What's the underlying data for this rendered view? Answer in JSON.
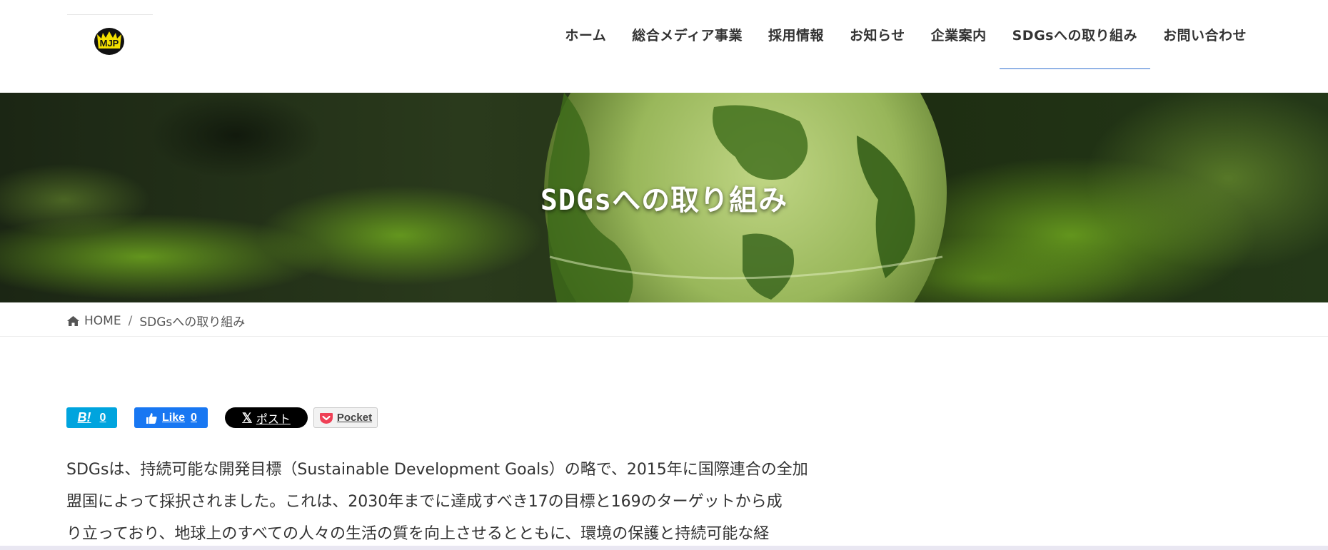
{
  "header": {
    "logo_text": "MJP",
    "nav": [
      {
        "label": "ホーム"
      },
      {
        "label": "総合メディア事業"
      },
      {
        "label": "採用情報"
      },
      {
        "label": "お知らせ"
      },
      {
        "label": "企業案内"
      },
      {
        "label": "SDGsへの取り組み",
        "current": true
      },
      {
        "label": "お問い合わせ"
      }
    ]
  },
  "hero": {
    "title": "SDGsへの取り組み"
  },
  "breadcrumb": {
    "home_label": "HOME",
    "separator": "/",
    "current_label": "SDGsへの取り組み"
  },
  "share": {
    "hatena_mark": "B!",
    "hatena_count": "0",
    "facebook_label": "Like",
    "facebook_count": "0",
    "x_label": "ポスト",
    "pocket_label": "Pocket"
  },
  "content": {
    "lines": [
      "SDGsは、持続可能な開発目標（Sustainable Development Goals）の略で、2015年に国際連合の全加",
      "盟国によって採択されました。これは、2030年までに達成すべき17の目標と169のターゲットから成",
      "り立っており、地球上のすべての人々の生活の質を向上させるとともに、環境の保護と持続可能な経"
    ]
  },
  "colors": {
    "nav_active_underline": "#2e6fd0",
    "hatena": "#00a4de",
    "facebook": "#1877f2",
    "x": "#000000"
  }
}
